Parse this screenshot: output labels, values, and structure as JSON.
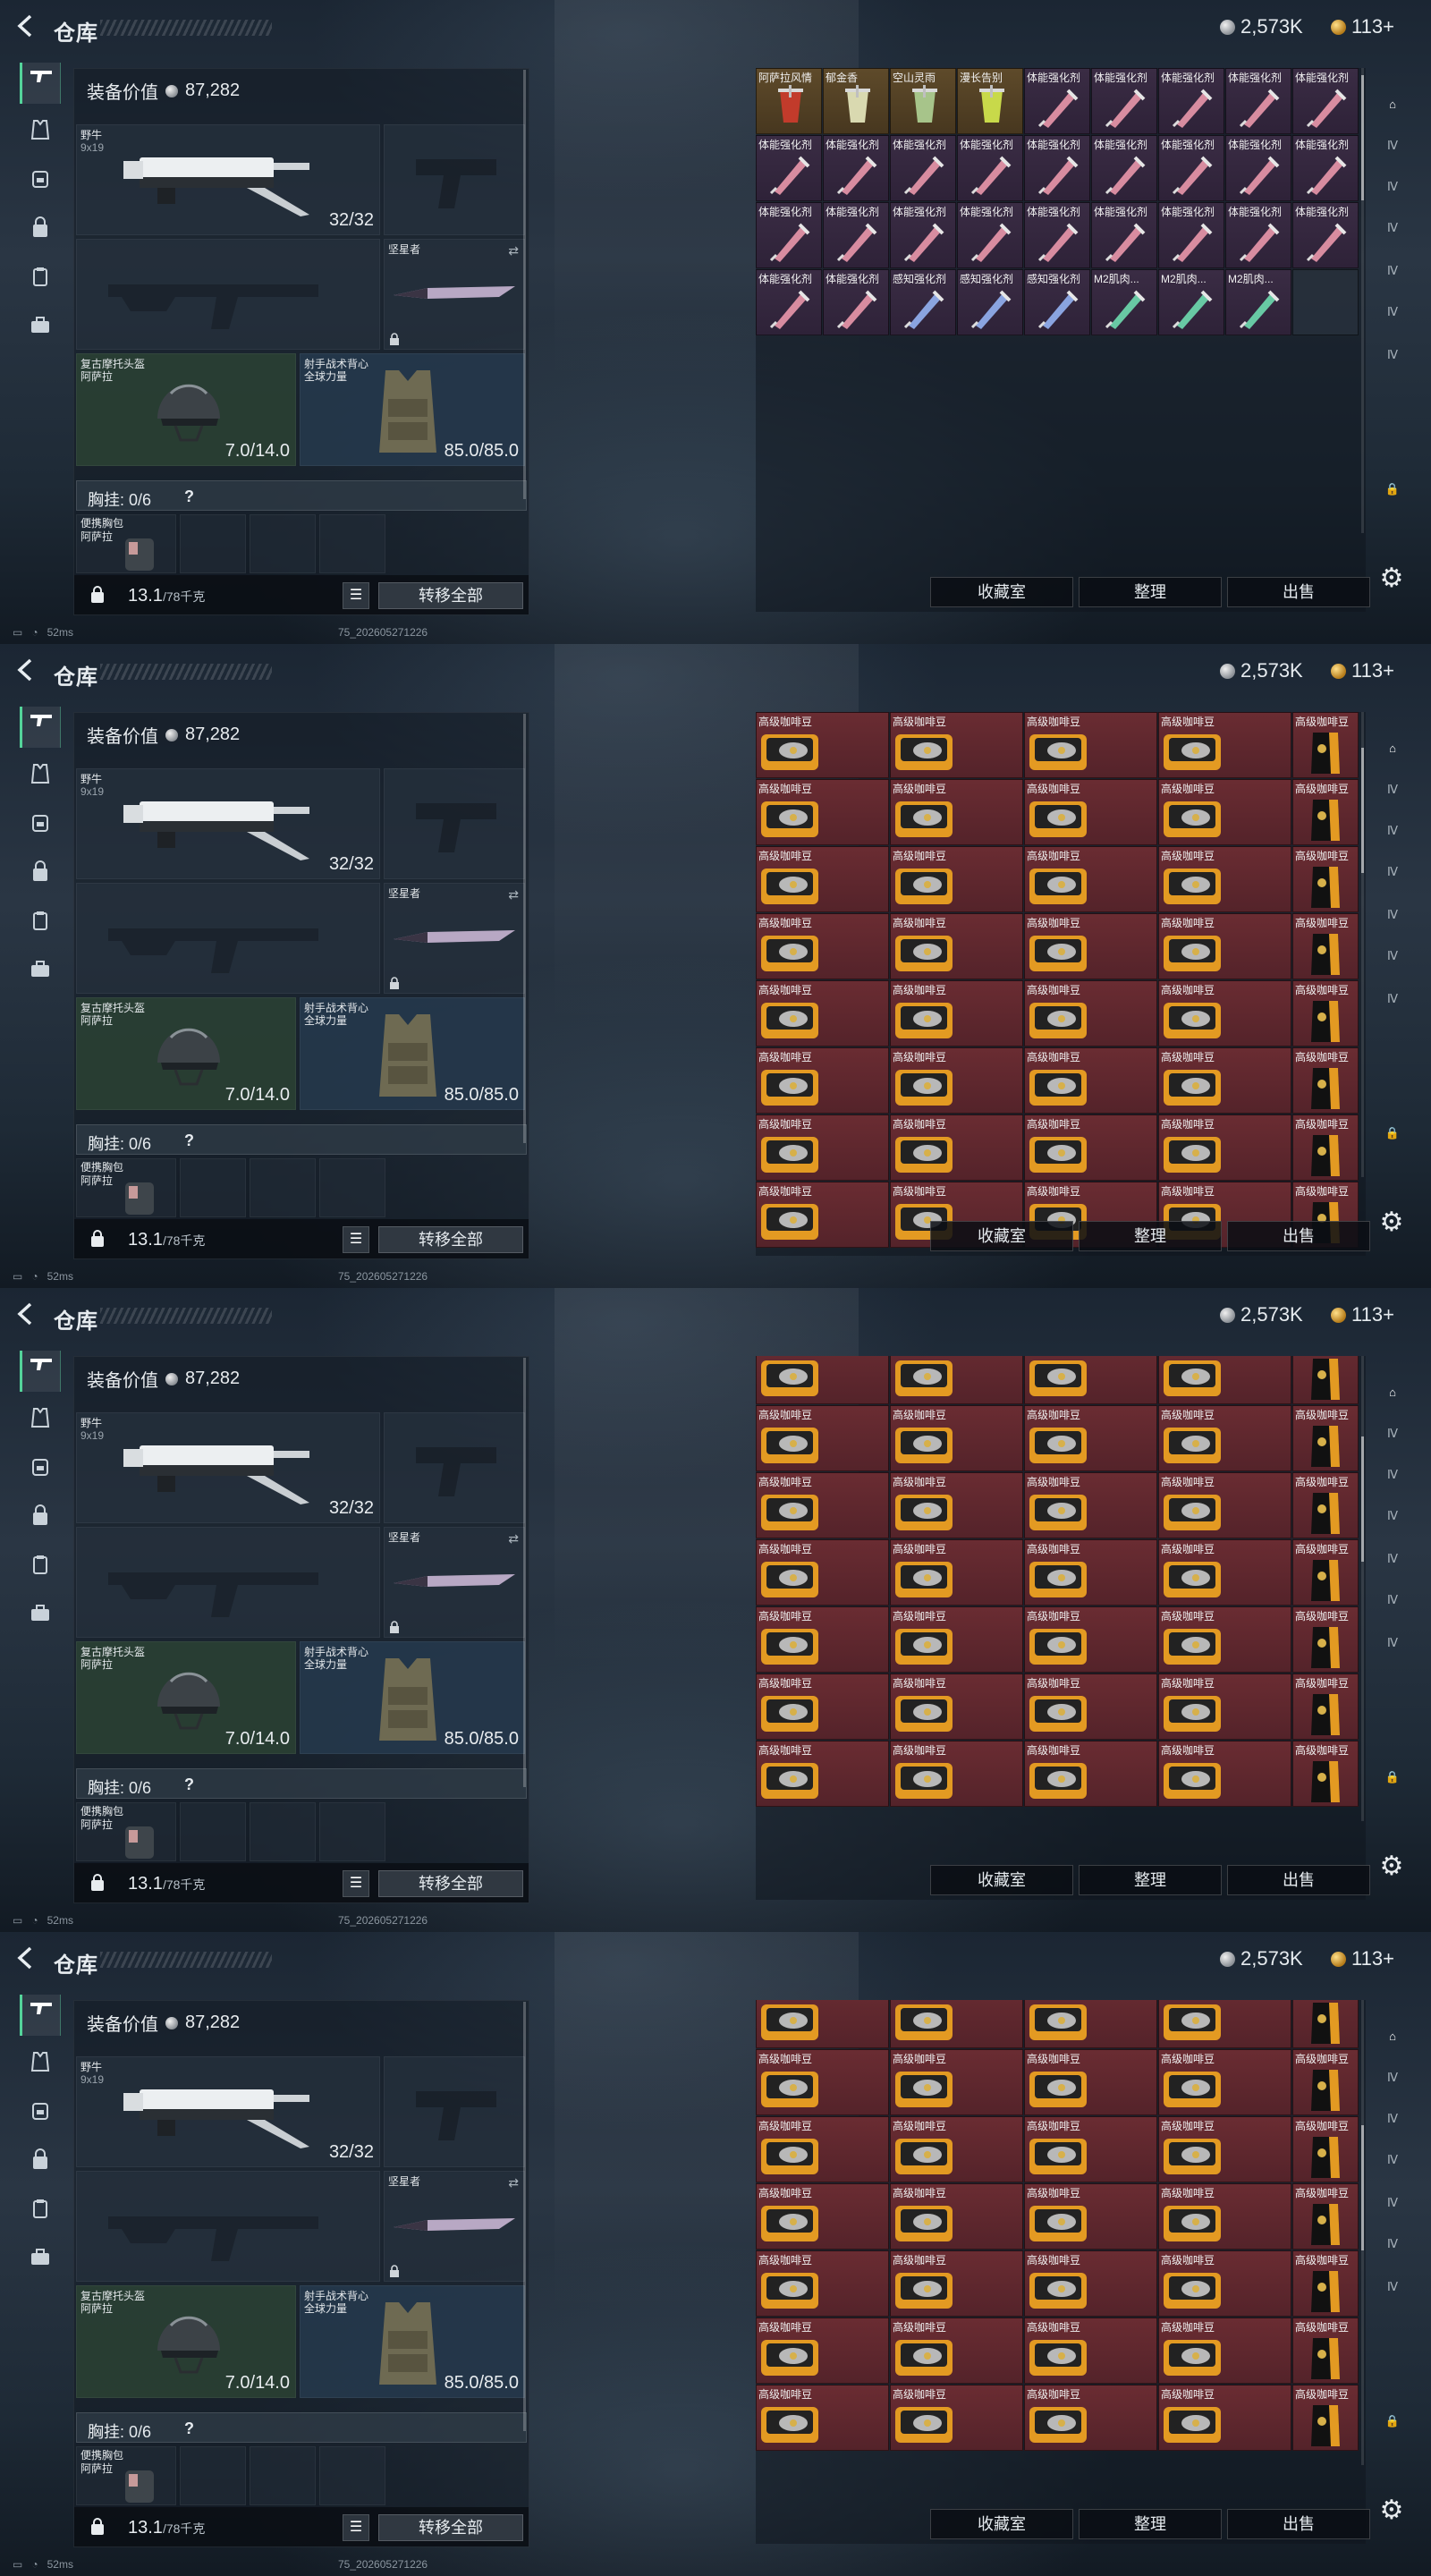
{
  "header": {
    "title": "仓库",
    "silver": "2,573K",
    "gold": "113+"
  },
  "loadout": {
    "value_label": "装备价值",
    "value": "87,282",
    "primary_weapon": {
      "name": "野牛",
      "caliber": "9x19",
      "ammo": "32/32"
    },
    "melee": {
      "name": "坚星者"
    },
    "helmet": {
      "name": "复古摩托头盔",
      "brand": "阿萨拉",
      "durability": "7.0/14.0"
    },
    "armor": {
      "name": "射手战术背心",
      "brand": "全球力量",
      "durability": "85.0/85.0"
    },
    "chest_rig": {
      "label": "胸挂: 0/6",
      "help": "?"
    },
    "pouch": {
      "name": "便携胸包",
      "brand": "阿萨拉"
    },
    "weight": "13.1",
    "weight_max": "/78千克",
    "transfer_all": "转移全部"
  },
  "status": {
    "ping": "52ms",
    "build": "75_202605271226"
  },
  "storage": {
    "actions": [
      "收藏室",
      "整理",
      "出售"
    ],
    "first_page_items": [
      "阿萨拉风情",
      "郁金香",
      "空山灵雨",
      "漫长告别",
      "体能强化剂",
      "体能强化剂",
      "体能强化剂",
      "体能强化剂",
      "体能强化剂",
      "体能强化剂",
      "体能强化剂",
      "体能强化剂",
      "体能强化剂",
      "体能强化剂",
      "体能强化剂",
      "体能强化剂",
      "体能强化剂",
      "体能强化剂",
      "体能强化剂",
      "体能强化剂",
      "体能强化剂",
      "体能强化剂",
      "体能强化剂",
      "体能强化剂",
      "体能强化剂",
      "体能强化剂",
      "体能强化剂",
      "体能强化剂",
      "体能强化剂",
      "感知强化剂",
      "感知强化剂",
      "感知强化剂",
      "M2肌肉...",
      "M2肌肉...",
      "M2肌肉...",
      ""
    ],
    "coffee_label": "高级咖啡豆"
  },
  "icons": {
    "back": "back-arrow-icon",
    "nav": [
      "rifle-icon",
      "vest-icon",
      "backpack-icon",
      "bag-icon",
      "clipboard-icon",
      "toolbox-icon"
    ],
    "rail": [
      "stash-1-icon",
      "stash-2-icon",
      "stash-3-icon",
      "stash-4-icon",
      "stash-5-icon",
      "stash-6-icon",
      "lock-icon"
    ],
    "settings": "gear-icon"
  },
  "colors": {
    "accent": "#54d39a",
    "coffee_cell": "#6a2c32",
    "enhancer_cell": "#3a2c44"
  }
}
